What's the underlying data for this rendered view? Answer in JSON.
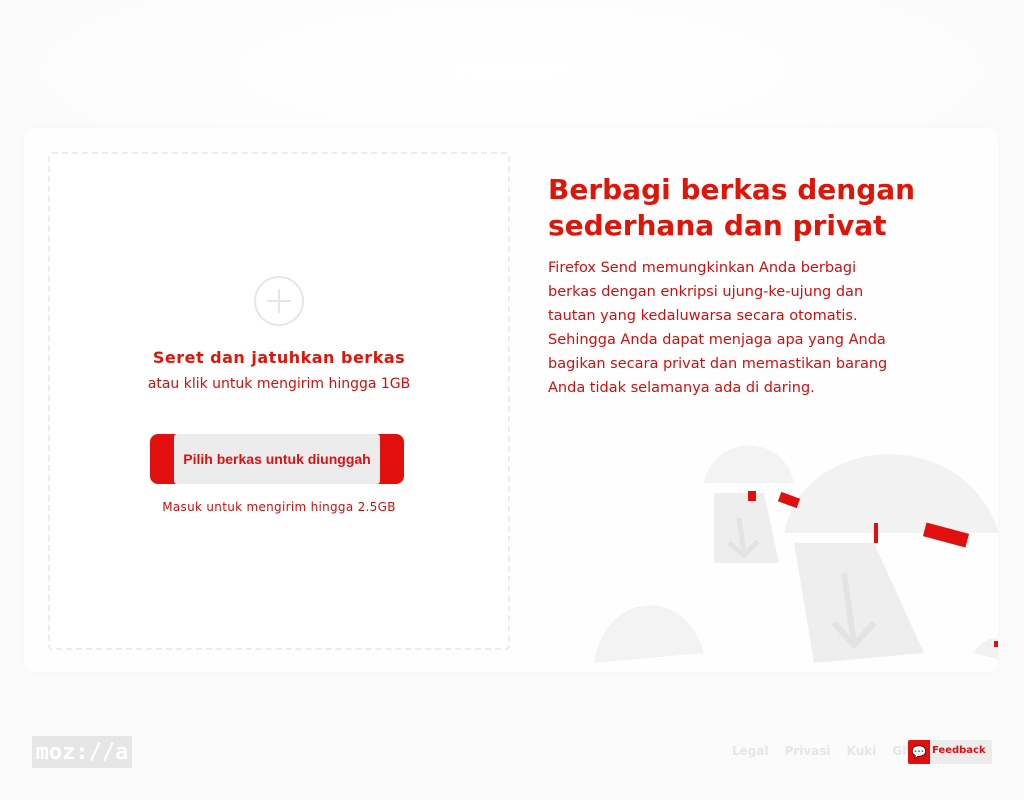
{
  "upload": {
    "title": "Seret dan jatuhkan berkas",
    "subtitle": "atau klik untuk mengirim hingga 1GB",
    "select_button": "Pilih berkas untuk diunggah",
    "signin_note": "Masuk untuk mengirim hingga 2.5GB"
  },
  "intro": {
    "title": "Berbagi berkas dengan sederhana dan privat",
    "body": "Firefox Send memungkinkan Anda berbagi berkas dengan enkripsi ujung-ke-ujung dan tautan yang kedaluwarsa secara otomatis. Sehingga Anda dapat menjaga apa yang Anda bagikan secara privat dan memastikan barang Anda tidak selamanya ada di daring."
  },
  "footer": {
    "logo_text": "moz://a",
    "links": [
      "Legal",
      "Privasi",
      "Kuki",
      "GitHub"
    ],
    "feedback_label": "Feedback",
    "feedback_icon": "speech-bubble-icon"
  },
  "colors": {
    "accent": "#e20f0f",
    "text_red": "#d10e0e",
    "muted": "#e6e6e6"
  }
}
